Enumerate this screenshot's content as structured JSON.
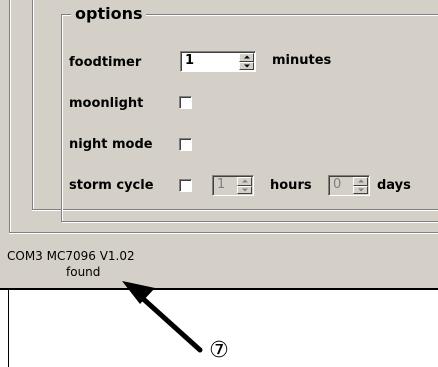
{
  "options_panel": {
    "title": "options",
    "foodtimer": {
      "label": "foodtimer",
      "value": "1",
      "unit": "minutes"
    },
    "moonlight": {
      "label": "moonlight",
      "checked": false
    },
    "night_mode": {
      "label": "night mode",
      "checked": false
    },
    "storm_cycle": {
      "label": "storm cycle",
      "checked": false,
      "hours_value": "1",
      "hours_unit": "hours",
      "days_value": "0",
      "days_unit": "days"
    }
  },
  "status_bar": {
    "line1": "COM3 MC7096 V1.02",
    "line2": "found"
  },
  "annotation": {
    "callout_number": "⑦"
  }
}
